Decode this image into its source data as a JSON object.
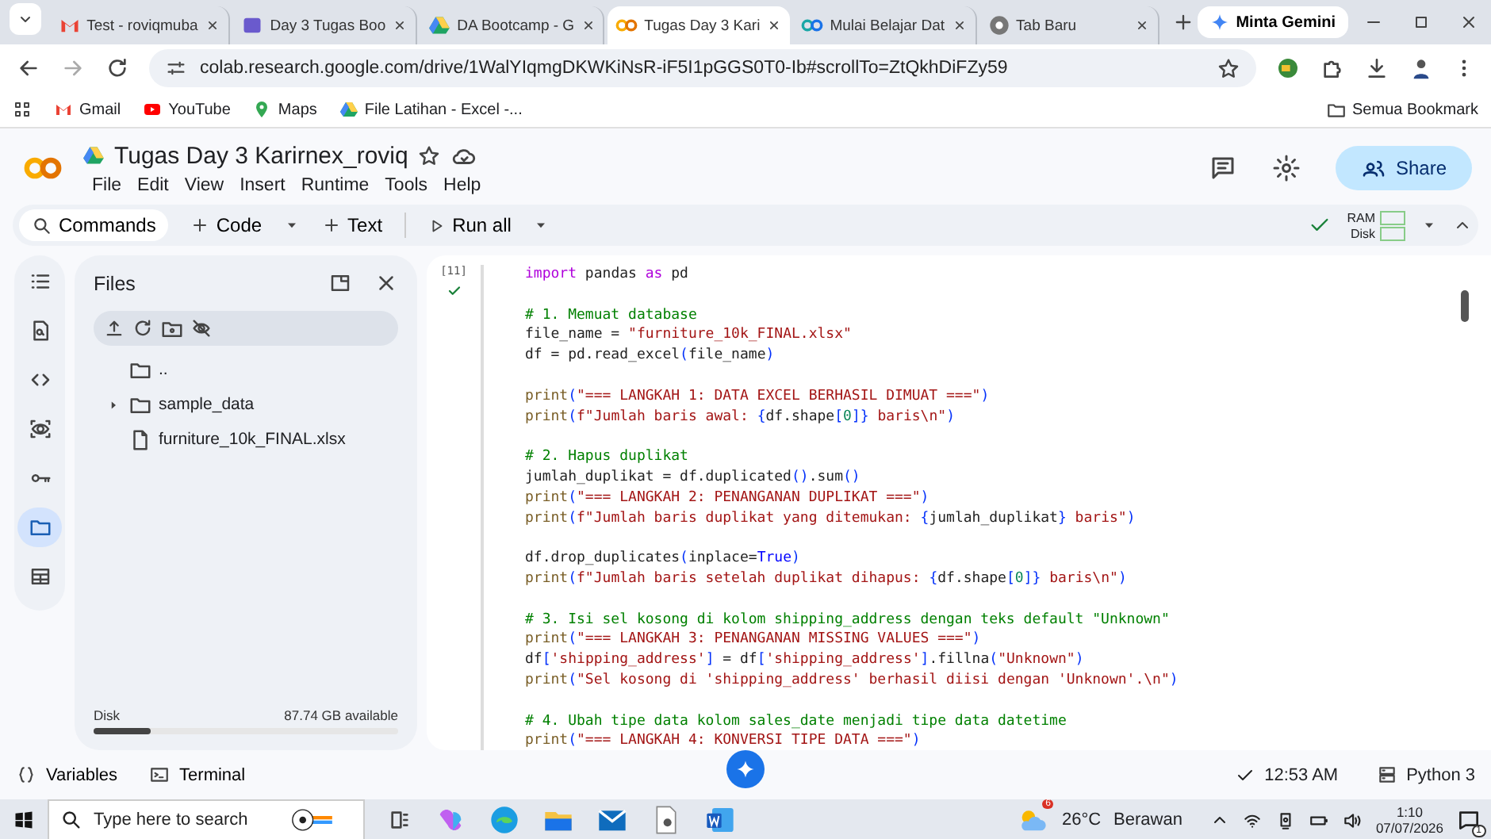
{
  "browser": {
    "tabs": [
      {
        "title": "Test - roviqmuba",
        "selected": false
      },
      {
        "title": "Day 3 Tugas Boo",
        "selected": false
      },
      {
        "title": "DA Bootcamp - G",
        "selected": false
      },
      {
        "title": "Tugas Day 3 Kari",
        "selected": true
      },
      {
        "title": "Mulai Belajar Dat",
        "selected": false
      },
      {
        "title": "Tab Baru",
        "selected": false
      }
    ],
    "gemini_button": "Minta Gemini",
    "url": "colab.research.google.com/drive/1WalYIqmgDKWKiNsR-iF5I1pGGS0T0-Ib#scrollTo=ZtQkhDiFZy59",
    "bookmarks": [
      "Gmail",
      "YouTube",
      "Maps",
      "File Latihan - Excel -..."
    ],
    "all_bookmarks": "Semua Bookmark"
  },
  "notebook": {
    "title": "Tugas Day 3 Karirnex_roviq",
    "menu": [
      "File",
      "Edit",
      "View",
      "Insert",
      "Runtime",
      "Tools",
      "Help"
    ],
    "share_button": "Share",
    "toolbar": {
      "commands": "Commands",
      "code": "Code",
      "text": "Text",
      "run_all": "Run all",
      "ram": "RAM",
      "disk": "Disk"
    }
  },
  "sidebar": {
    "items": [
      {
        "selected": false
      },
      {
        "selected": false
      },
      {
        "selected": false
      },
      {
        "selected": false
      },
      {
        "selected": false
      },
      {
        "selected": true
      },
      {
        "selected": false
      }
    ]
  },
  "files_panel": {
    "title": "Files",
    "items": [
      {
        "kind": "parent",
        "name": ".."
      },
      {
        "kind": "folder",
        "name": "sample_data"
      },
      {
        "kind": "file",
        "name": "furniture_10k_FINAL.xlsx"
      }
    ],
    "disk": {
      "label": "Disk",
      "available": "87.74 GB available",
      "level": 0.19
    }
  },
  "cell": {
    "counter": "[11]",
    "code_blocks": [
      [
        [
          {
            "kind": "kw",
            "text": "import"
          },
          {
            "kind": "p",
            "text": " pandas "
          },
          {
            "kind": "kw",
            "text": "as"
          },
          {
            "kind": "p",
            "text": " pd"
          }
        ]
      ],
      [
        [
          {
            "kind": "c",
            "text": "# 1. Memuat database"
          }
        ],
        [
          {
            "kind": "p",
            "text": "file_name = "
          },
          {
            "kind": "s",
            "text": "\"furniture_10k_FINAL.xlsx\""
          }
        ],
        [
          {
            "kind": "p",
            "text": "df = pd.read_excel"
          },
          {
            "kind": "b",
            "text": "("
          },
          {
            "kind": "p",
            "text": "file_name"
          },
          {
            "kind": "b",
            "text": ")"
          }
        ]
      ],
      [
        [
          {
            "kind": "f",
            "text": "print"
          },
          {
            "kind": "b",
            "text": "("
          },
          {
            "kind": "s",
            "text": "\"=== LANGKAH 1: DATA EXCEL BERHASIL DIMUAT ===\""
          },
          {
            "kind": "b",
            "text": ")"
          }
        ],
        [
          {
            "kind": "f",
            "text": "print"
          },
          {
            "kind": "b",
            "text": "("
          },
          {
            "kind": "s",
            "text": "f\"Jumlah baris awal: "
          },
          {
            "kind": "b",
            "text": "{"
          },
          {
            "kind": "p",
            "text": "df.shape"
          },
          {
            "kind": "b",
            "text": "["
          },
          {
            "kind": "n",
            "text": "0"
          },
          {
            "kind": "b",
            "text": "]}"
          },
          {
            "kind": "s",
            "text": " baris\\n\""
          },
          {
            "kind": "b",
            "text": ")"
          }
        ]
      ],
      [
        [
          {
            "kind": "c",
            "text": "# 2. Hapus duplikat"
          }
        ],
        [
          {
            "kind": "p",
            "text": "jumlah_duplikat = df.duplicated"
          },
          {
            "kind": "b",
            "text": "()"
          },
          {
            "kind": "p",
            "text": ".sum"
          },
          {
            "kind": "b",
            "text": "()"
          }
        ],
        [
          {
            "kind": "f",
            "text": "print"
          },
          {
            "kind": "b",
            "text": "("
          },
          {
            "kind": "s",
            "text": "\"=== LANGKAH 2: PENANGANAN DUPLIKAT ===\""
          },
          {
            "kind": "b",
            "text": ")"
          }
        ],
        [
          {
            "kind": "f",
            "text": "print"
          },
          {
            "kind": "b",
            "text": "("
          },
          {
            "kind": "s",
            "text": "f\"Jumlah baris duplikat yang ditemukan: "
          },
          {
            "kind": "b",
            "text": "{"
          },
          {
            "kind": "p",
            "text": "jumlah_duplikat"
          },
          {
            "kind": "b",
            "text": "}"
          },
          {
            "kind": "s",
            "text": " baris\""
          },
          {
            "kind": "b",
            "text": ")"
          }
        ]
      ],
      [
        [
          {
            "kind": "p",
            "text": "df.drop_duplicates"
          },
          {
            "kind": "b",
            "text": "("
          },
          {
            "kind": "p",
            "text": "inplace="
          },
          {
            "kind": "k",
            "text": "True"
          },
          {
            "kind": "b",
            "text": ")"
          }
        ],
        [
          {
            "kind": "f",
            "text": "print"
          },
          {
            "kind": "b",
            "text": "("
          },
          {
            "kind": "s",
            "text": "f\"Jumlah baris setelah duplikat dihapus: "
          },
          {
            "kind": "b",
            "text": "{"
          },
          {
            "kind": "p",
            "text": "df.shape"
          },
          {
            "kind": "b",
            "text": "["
          },
          {
            "kind": "n",
            "text": "0"
          },
          {
            "kind": "b",
            "text": "]}"
          },
          {
            "kind": "s",
            "text": " baris\\n\""
          },
          {
            "kind": "b",
            "text": ")"
          }
        ]
      ],
      [
        [
          {
            "kind": "c",
            "text": "# 3. Isi sel kosong di kolom shipping_address dengan teks default \"Unknown\""
          }
        ],
        [
          {
            "kind": "f",
            "text": "print"
          },
          {
            "kind": "b",
            "text": "("
          },
          {
            "kind": "s",
            "text": "\"=== LANGKAH 3: PENANGANAN MISSING VALUES ===\""
          },
          {
            "kind": "b",
            "text": ")"
          }
        ],
        [
          {
            "kind": "p",
            "text": "df"
          },
          {
            "kind": "b",
            "text": "["
          },
          {
            "kind": "s",
            "text": "'shipping_address'"
          },
          {
            "kind": "b",
            "text": "]"
          },
          {
            "kind": "p",
            "text": " = df"
          },
          {
            "kind": "b",
            "text": "["
          },
          {
            "kind": "s",
            "text": "'shipping_address'"
          },
          {
            "kind": "b",
            "text": "]"
          },
          {
            "kind": "p",
            "text": ".fillna"
          },
          {
            "kind": "b",
            "text": "("
          },
          {
            "kind": "s",
            "text": "\"Unknown\""
          },
          {
            "kind": "b",
            "text": ")"
          }
        ],
        [
          {
            "kind": "f",
            "text": "print"
          },
          {
            "kind": "b",
            "text": "("
          },
          {
            "kind": "s",
            "text": "\"Sel kosong di 'shipping_address' berhasil diisi dengan 'Unknown'.\\n\""
          },
          {
            "kind": "b",
            "text": ")"
          }
        ]
      ],
      [
        [
          {
            "kind": "c",
            "text": "# 4. Ubah tipe data kolom sales_date menjadi tipe data datetime"
          }
        ],
        [
          {
            "kind": "f",
            "text": "print"
          },
          {
            "kind": "b",
            "text": "("
          },
          {
            "kind": "s",
            "text": "\"=== LANGKAH 4: KONVERSI TIPE DATA ===\""
          },
          {
            "kind": "b",
            "text": ")"
          }
        ]
      ]
    ]
  },
  "status_bar": {
    "variables": "Variables",
    "terminal": "Terminal",
    "time": "12:53 AM",
    "runtime": "Python 3"
  },
  "taskbar": {
    "search_placeholder": "Type here to search",
    "weather_badge": "6",
    "temperature": "26°C",
    "weather": "Berawan",
    "time": "1:10",
    "date": "07/07/2026",
    "notifications": "1"
  }
}
